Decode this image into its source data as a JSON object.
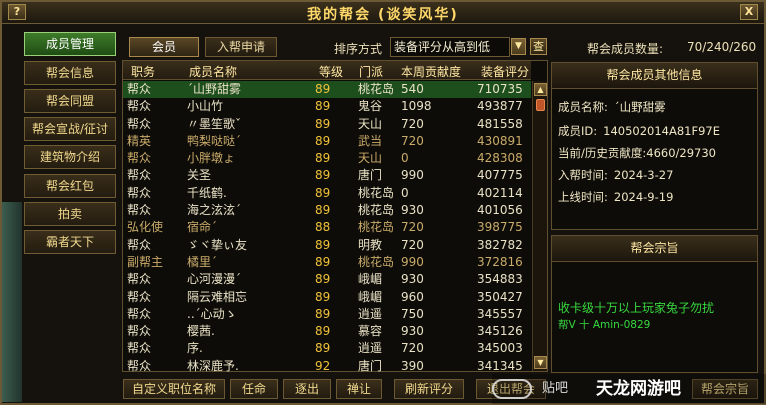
{
  "window": {
    "title": "我的帮会 (谈笑风华)",
    "help_label": "?",
    "close_label": "X"
  },
  "sidebar": {
    "items": [
      {
        "label": "成员管理",
        "active": true
      },
      {
        "label": "帮会信息"
      },
      {
        "label": "帮会同盟"
      },
      {
        "label": "帮会宣战/征讨"
      },
      {
        "label": "建筑物介绍"
      },
      {
        "label": "帮会红包"
      },
      {
        "label": "拍卖"
      },
      {
        "label": "霸者天下"
      }
    ]
  },
  "tabs": [
    {
      "label": "会员",
      "active": true
    },
    {
      "label": "入帮申请"
    }
  ],
  "sort": {
    "label": "排序方式",
    "selected": "装备评分从高到低",
    "search_label": "查"
  },
  "member_count": {
    "label": "帮会成员数量:",
    "value": "70/240/260"
  },
  "table": {
    "headers": [
      "职务",
      "成员名称",
      "等级",
      "门派",
      "本周贡献度",
      "装备评分"
    ],
    "rows": [
      {
        "pos": "帮众",
        "name": "ˊ山野甜雾",
        "lvl": "89",
        "sect": "桃花岛",
        "contrib": "540",
        "score": "710735",
        "selected": true
      },
      {
        "pos": "帮众",
        "name": "小山竹",
        "lvl": "89",
        "sect": "鬼谷",
        "contrib": "1098",
        "score": "493877"
      },
      {
        "pos": "帮众",
        "name": "〃墨笙歌ˇ",
        "lvl": "89",
        "sect": "天山",
        "contrib": "720",
        "score": "481558"
      },
      {
        "pos": "精英",
        "name": "鸭梨哒哒ˊ",
        "lvl": "89",
        "sect": "武当",
        "contrib": "720",
        "score": "430891",
        "gold": true
      },
      {
        "pos": "帮众",
        "name": "小胖墩ょ",
        "lvl": "89",
        "sect": "天山",
        "contrib": "0",
        "score": "428308",
        "gold": true
      },
      {
        "pos": "帮众",
        "name": "关圣",
        "lvl": "89",
        "sect": "唐门",
        "contrib": "990",
        "score": "407775"
      },
      {
        "pos": "帮众",
        "name": "千纸鹤.",
        "lvl": "89",
        "sect": "桃花岛",
        "contrib": "0",
        "score": "402114"
      },
      {
        "pos": "帮众",
        "name": "海之泫泫ˊ",
        "lvl": "89",
        "sect": "桃花岛",
        "contrib": "930",
        "score": "401056"
      },
      {
        "pos": "弘化使",
        "name": "宿命ˊ",
        "lvl": "88",
        "sect": "桃花岛",
        "contrib": "720",
        "score": "398775",
        "gold": true
      },
      {
        "pos": "帮众",
        "name": "ゞヾ挚ぃ友",
        "lvl": "89",
        "sect": "明教",
        "contrib": "720",
        "score": "382782"
      },
      {
        "pos": "副帮主",
        "name": "橘里ˊ",
        "lvl": "89",
        "sect": "桃花岛",
        "contrib": "990",
        "score": "372816",
        "gold": true
      },
      {
        "pos": "帮众",
        "name": "心河漫漫ˊ",
        "lvl": "89",
        "sect": "峨嵋",
        "contrib": "930",
        "score": "354883"
      },
      {
        "pos": "帮众",
        "name": "隔云难相忘",
        "lvl": "89",
        "sect": "峨嵋",
        "contrib": "960",
        "score": "350427"
      },
      {
        "pos": "帮众",
        "name": "..ˊ心动ゝ",
        "lvl": "89",
        "sect": "逍遥",
        "contrib": "750",
        "score": "345557"
      },
      {
        "pos": "帮众",
        "name": "樱茜.",
        "lvl": "89",
        "sect": "慕容",
        "contrib": "930",
        "score": "345126"
      },
      {
        "pos": "帮众",
        "name": "序.",
        "lvl": "89",
        "sect": "逍遥",
        "contrib": "720",
        "score": "345003"
      },
      {
        "pos": "帮众",
        "name": "林深鹿予.",
        "lvl": "92",
        "sect": "唐门",
        "contrib": "390",
        "score": "341345"
      }
    ]
  },
  "bottom_buttons": [
    {
      "label": "自定义职位名称"
    },
    {
      "label": "任命"
    },
    {
      "label": "逐出"
    },
    {
      "label": "禅让"
    },
    {
      "label": "刷新评分"
    },
    {
      "label": "退出帮会"
    }
  ],
  "member_info": {
    "title": "帮会成员其他信息",
    "fields": [
      {
        "label": "成员名称:",
        "value": "ˊ山野甜雾"
      },
      {
        "label": "成员ID:",
        "value": "140502014A81F97E"
      },
      {
        "label": "当前/历史贡献度:",
        "value": "4660/29730"
      },
      {
        "label": "入帮时间:",
        "value": "2024-3-27"
      },
      {
        "label": "上线时间:",
        "value": "2024-9-19"
      }
    ]
  },
  "motto": {
    "title": "帮会宗旨",
    "line1": "收卡级十万以上玩家兔子勿扰",
    "line2": "帮V 十 Amin-0829",
    "button_label": "帮会宗旨"
  },
  "watermark": {
    "small": "贴吧",
    "big": "天龙网游吧"
  },
  "colors": {
    "accent_green": "#1d4f1c",
    "title_gold": "#ffd86a",
    "motto_green": "#36d93f",
    "level_gold": "#f0c33a"
  }
}
